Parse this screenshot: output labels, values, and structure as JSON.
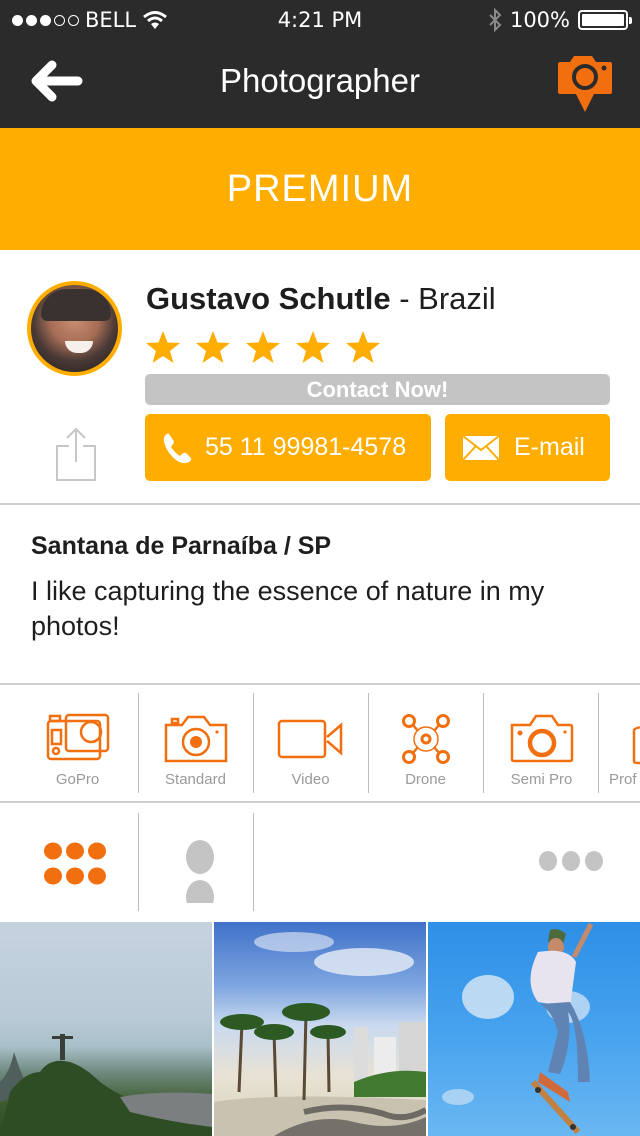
{
  "status_bar": {
    "carrier": "BELL",
    "signal_bars_filled": 3,
    "signal_bars_total": 5,
    "time": "4:21 PM",
    "battery": "100%",
    "battery_level": 1.0
  },
  "nav": {
    "title": "Photographer",
    "back_icon": "arrow-left-icon",
    "action_icon": "camera-location-pin-icon"
  },
  "banner": {
    "label": "PREMIUM"
  },
  "profile": {
    "name": "Gustavo Schutle",
    "country_sep": " - ",
    "country": "Brazil",
    "rating": 5,
    "rating_max": 5,
    "contact_label": "Contact Now!",
    "phone": "55 11 99981-4578",
    "email_label": "E-mail",
    "share_icon": "share-icon"
  },
  "about": {
    "location": "Santana de Parnaíba / SP",
    "bio": "I like capturing the essence of nature in my photos!"
  },
  "categories": [
    {
      "label": "GoPro",
      "icon": "gopro-icon"
    },
    {
      "label": "Standard",
      "icon": "camera-icon"
    },
    {
      "label": "Video",
      "icon": "video-camera-icon"
    },
    {
      "label": "Drone",
      "icon": "drone-icon"
    },
    {
      "label": "Semi Pro",
      "icon": "semi-pro-camera-icon"
    },
    {
      "label": "Prof",
      "icon": "professional-camera-icon"
    }
  ],
  "views": {
    "active": "grid",
    "options": [
      "grid",
      "list",
      "more"
    ]
  },
  "photos": [
    {
      "alt": "Christ the Redeemer over Rio de Janeiro"
    },
    {
      "alt": "Copacabana boardwalk with palm trees"
    },
    {
      "alt": "Skateboarder jumping against blue sky"
    }
  ],
  "colors": {
    "accent": "#ffad00",
    "icon_orange": "#f26f0f",
    "header_bg": "#2b2b2b",
    "inactive_gray": "#c4c4c4"
  }
}
